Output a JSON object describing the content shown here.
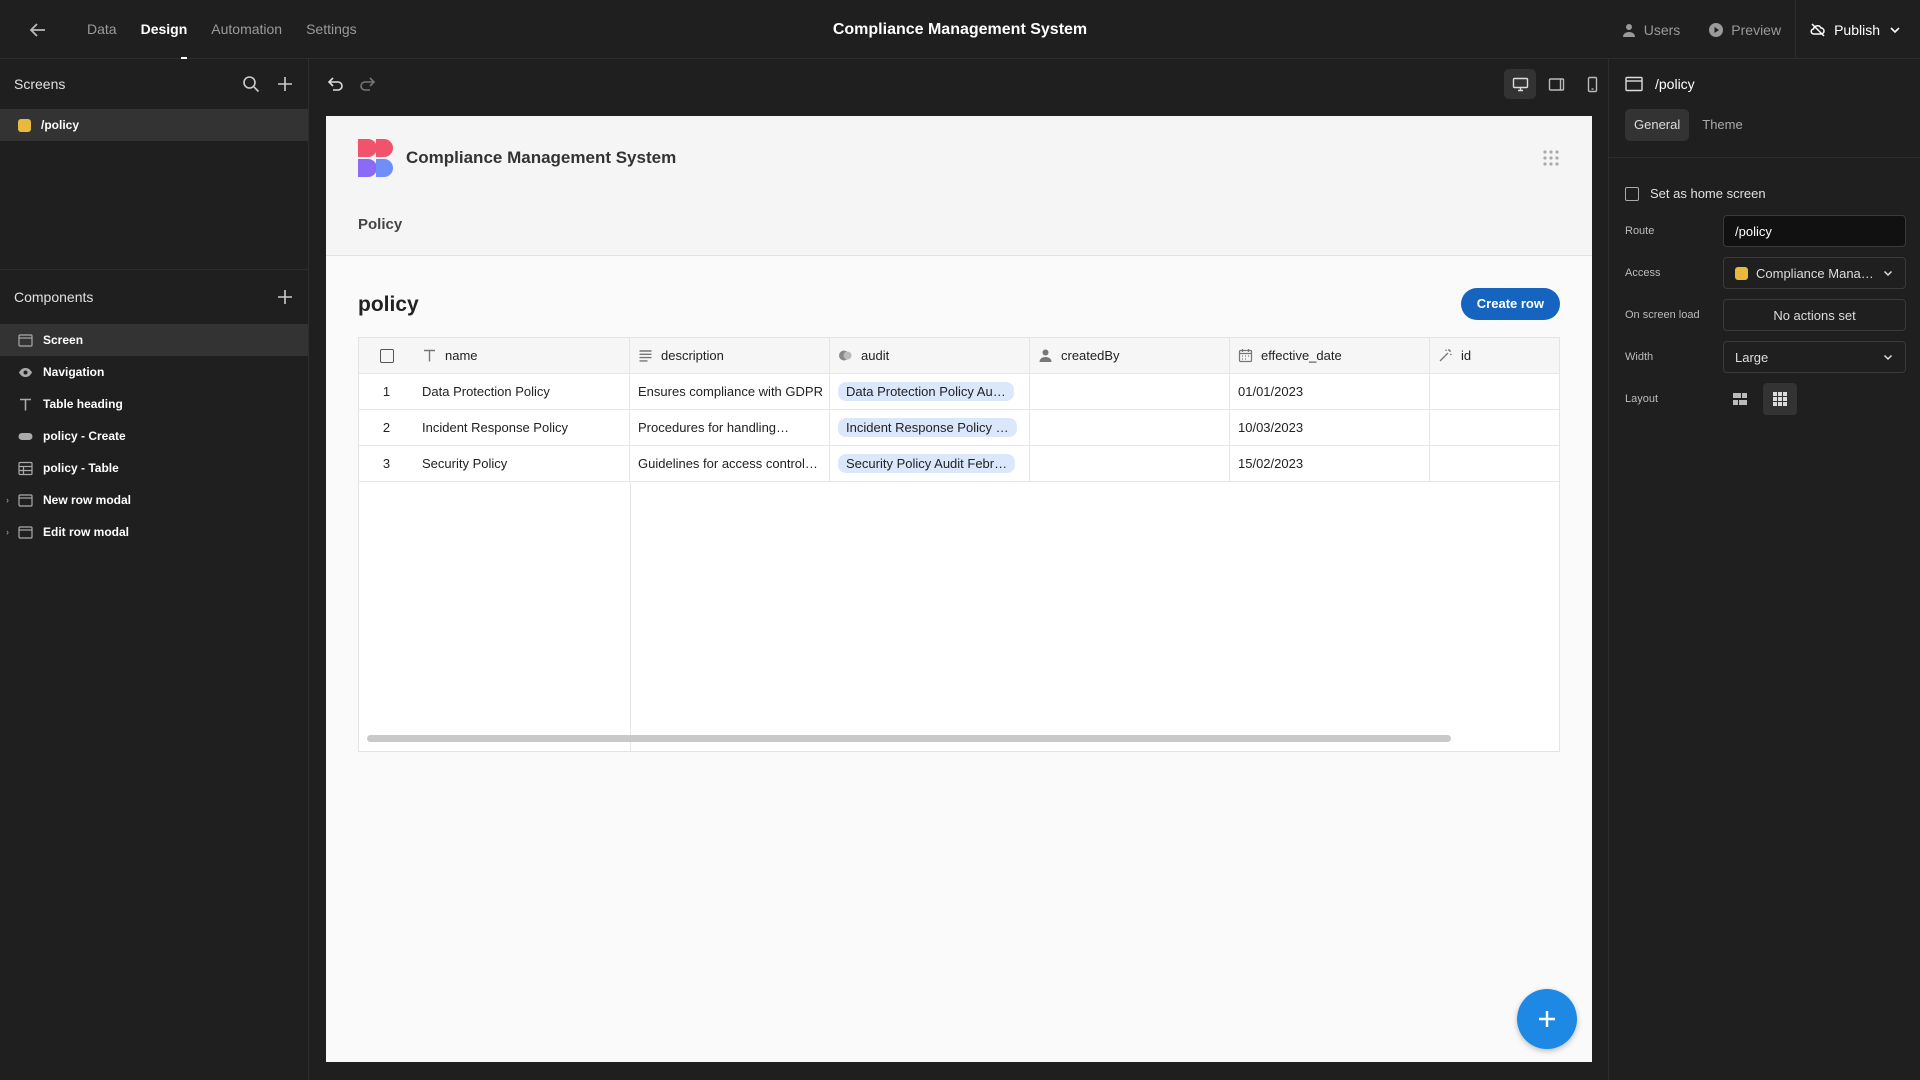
{
  "topbar": {
    "tabs": [
      "Data",
      "Design",
      "Automation",
      "Settings"
    ],
    "active_tab": "Design",
    "app_title": "Compliance Management System",
    "users_label": "Users",
    "preview_label": "Preview",
    "publish_label": "Publish"
  },
  "screens_panel": {
    "title": "Screens",
    "items": [
      {
        "label": "/policy",
        "color": "#e8b93b"
      }
    ]
  },
  "components_panel": {
    "title": "Components",
    "items": [
      {
        "label": "Screen",
        "icon": "screen-icon"
      },
      {
        "label": "Navigation",
        "icon": "eye-icon"
      },
      {
        "label": "Table heading",
        "icon": "text-icon"
      },
      {
        "label": "policy - Create",
        "icon": "button-icon"
      },
      {
        "label": "policy - Table",
        "icon": "table-icon"
      },
      {
        "label": "New row modal",
        "icon": "modal-icon"
      },
      {
        "label": "Edit row modal",
        "icon": "modal-icon"
      }
    ]
  },
  "preview": {
    "brand": "Compliance Management System",
    "nav_link": "Policy",
    "heading": "policy",
    "create_button": "Create row",
    "accent_color": "#1565c0",
    "table": {
      "columns": [
        {
          "label": "name",
          "icon": "text-type-icon"
        },
        {
          "label": "description",
          "icon": "long-text-icon"
        },
        {
          "label": "audit",
          "icon": "relationship-icon"
        },
        {
          "label": "createdBy",
          "icon": "user-icon"
        },
        {
          "label": "effective_date",
          "icon": "calendar-icon"
        },
        {
          "label": "id",
          "icon": "magic-wand-icon"
        }
      ],
      "rows": [
        {
          "num": "1",
          "name": "Data Protection Policy",
          "description": "Ensures compliance with GDPR",
          "audit": "Data Protection Policy Au…",
          "createdBy": "",
          "effective_date": "01/01/2023",
          "id": ""
        },
        {
          "num": "2",
          "name": "Incident Response Policy",
          "description": "Procedures for handling…",
          "audit": "Incident Response Policy …",
          "createdBy": "",
          "effective_date": "10/03/2023",
          "id": ""
        },
        {
          "num": "3",
          "name": "Security Policy",
          "description": "Guidelines for access control…",
          "audit": "Security Policy Audit Febr…",
          "createdBy": "",
          "effective_date": "15/02/2023",
          "id": ""
        }
      ]
    }
  },
  "settings_panel": {
    "screen_name": "/policy",
    "tabs": [
      "General",
      "Theme"
    ],
    "active_tab": "General",
    "home_screen_label": "Set as home screen",
    "home_screen_checked": false,
    "route_label": "Route",
    "route_value": "/policy",
    "access_label": "Access",
    "access_value": "Compliance Mana…",
    "on_load_label": "On screen load",
    "on_load_value": "No actions set",
    "width_label": "Width",
    "width_value": "Large",
    "layout_label": "Layout"
  }
}
